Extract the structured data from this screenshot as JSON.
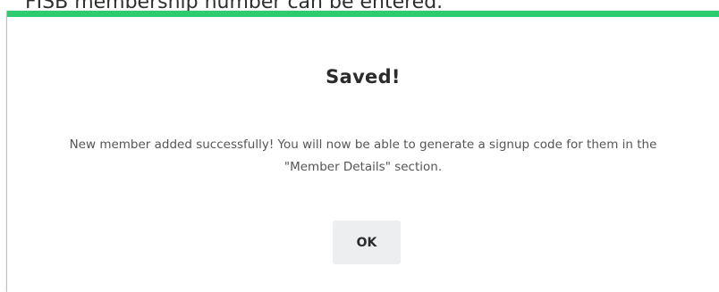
{
  "background": {
    "partial_text": "FISB membership number can be entered."
  },
  "dialog": {
    "title": "Saved!",
    "message": "New member added successfully! You will now be able to generate a signup code for them in the \"Member Details\" section.",
    "ok_label": "OK",
    "accent_color": "#2ecc71"
  }
}
